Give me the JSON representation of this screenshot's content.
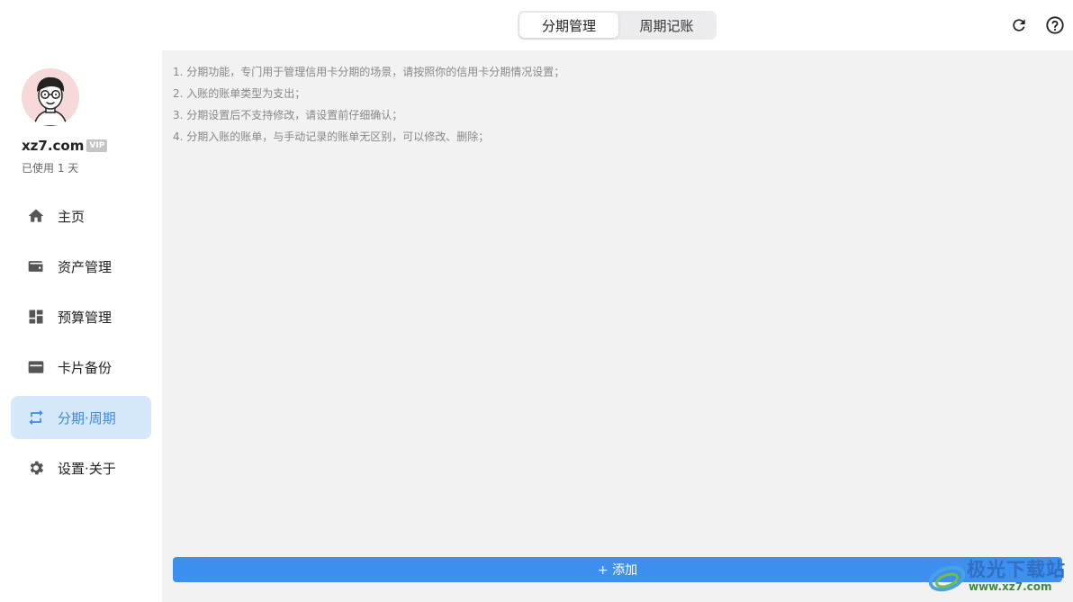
{
  "header": {
    "tabs": [
      {
        "label": "分期管理",
        "active": true
      },
      {
        "label": "周期记账",
        "active": false
      }
    ],
    "refresh_icon": "refresh-icon",
    "help_icon": "help-circle-icon"
  },
  "sidebar": {
    "username": "xz7.com",
    "badge": "VIP",
    "usage": "已使用 1 天",
    "items": [
      {
        "label": "主页",
        "icon": "home-icon"
      },
      {
        "label": "资产管理",
        "icon": "wallet-icon"
      },
      {
        "label": "预算管理",
        "icon": "dashboard-icon"
      },
      {
        "label": "卡片备份",
        "icon": "card-icon"
      },
      {
        "label": "分期·周期",
        "icon": "repeat-icon",
        "active": true
      },
      {
        "label": "设置·关于",
        "icon": "gear-icon"
      }
    ]
  },
  "main": {
    "notes": [
      "1. 分期功能，专门用于管理信用卡分期的场景，请按照你的信用卡分期情况设置；",
      "2. 入账的账单类型为支出；",
      "3. 分期设置后不支持修改，请设置前仔细确认；",
      "4. 分期入账的账单，与手动记录的账单无区别，可以修改、删除；"
    ],
    "add_label": "+ 添加"
  },
  "watermark": {
    "title": "极光下载站",
    "url": "www.xz7.com"
  },
  "colors": {
    "accent": "#3d8ff0",
    "active_bg": "#d6e8fc",
    "main_bg": "#f2f2f2"
  }
}
